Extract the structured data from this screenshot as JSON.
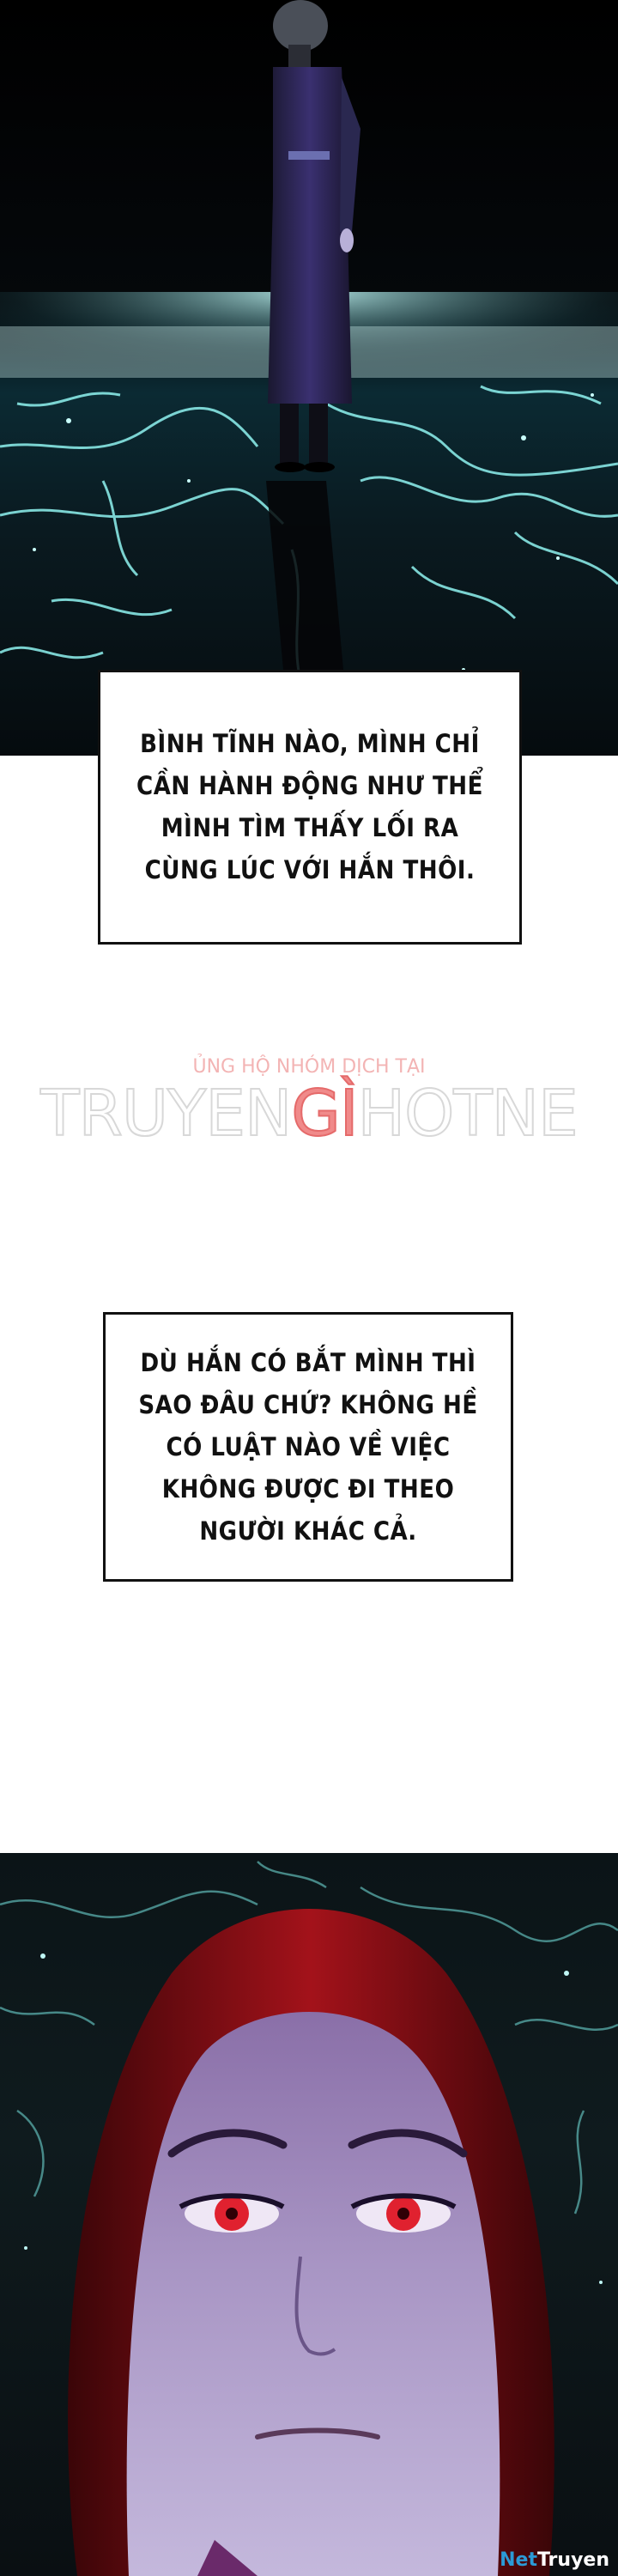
{
  "captions": {
    "caption_1": "BÌNH TĨNH NÀO, MÌNH CHỈ CẦN HÀNH ĐỘNG NHƯ THỂ MÌNH TÌM THẤY LỐI RA CÙNG LÚC VỚI HẮN THÔI.",
    "caption_2": "DÙ HẮN CÓ BẮT MÌNH THÌ SAO ĐÂU CHỨ? KHÔNG HỀ CÓ LUẬT NÀO VỀ VIỆC KHÔNG ĐƯỢC ĐI THEO NGƯỜI KHÁC CẢ."
  },
  "watermark": {
    "tagline": "ỦNG HỘ NHÓM DỊCH TẠI",
    "name_part_1": "TRUYEN",
    "name_accent": "GÌ",
    "name_part_2": "HOTNE"
  },
  "logo": {
    "part_1": "Net",
    "part_2": "Truyen"
  },
  "colors": {
    "crack_glow": "#8ff3f0",
    "hair_red": "#a3121a",
    "skin": "#9a85b4",
    "eyes": "#e0212f",
    "watermark_accent": "#f08a8a",
    "logo_blue": "#2b9ad6"
  }
}
